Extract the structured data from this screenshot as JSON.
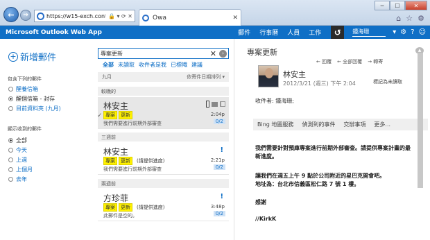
{
  "browser": {
    "url": "https://w15-exch.conto...",
    "tab_title": "Owa",
    "url_symbols": "🔒 ▾ ⟳ ✕",
    "win_min": "─",
    "win_max": "☐",
    "win_close": "✕",
    "toolbar_icons": [
      "⌂",
      "☆",
      "⚙"
    ]
  },
  "owa": {
    "brand": "Microsoft Outlook Web App",
    "nav": [
      "郵件",
      "行事曆",
      "人員",
      "工作"
    ],
    "logo": "↺",
    "user": "鍾海珊 ",
    "top_icons": [
      "▾",
      "⚙",
      "?",
      "☺"
    ]
  },
  "sidebar": {
    "new_mail": "新增郵件",
    "section1": "包含下列的郵件",
    "folders": [
      "醒養信箱",
      "醒個信箱 - 封存",
      "目前資料夾 (九月)"
    ],
    "section2": "顯示收到的郵件",
    "ranges": [
      "全部",
      "今天",
      "上週",
      "上個月",
      "去年"
    ]
  },
  "list": {
    "search": "專案更新",
    "filters": [
      "全部",
      "未讀取",
      "收件者是我",
      "已標幟",
      "建議"
    ],
    "header_left": "九月",
    "header_right": "依寄件日期排列 ▾",
    "groups": [
      "較晚的",
      "三週前",
      "兩週前"
    ],
    "items": [
      {
        "name": "林安主",
        "tag1": "專案",
        "tag2": "更新",
        "subject": "",
        "preview": "我們需要進行前期外部審查",
        "time": "2:04p",
        "count": "0/2"
      },
      {
        "name": "林安主",
        "tag1": "專案",
        "tag2": "更新",
        "subject": "(請提供進度)",
        "preview": "我們需要進行前期外部審查",
        "time": "2:21p",
        "count": "0/2"
      },
      {
        "name": "方珍菲",
        "tag1": "專案",
        "tag2": "更新",
        "subject": "(請提供進度)",
        "preview": "此郵件是空的。",
        "time": "3:48p",
        "count": "0/2"
      }
    ],
    "important": "!",
    "check": "✓"
  },
  "reading": {
    "title": "專案更新",
    "actions": [
      "← 回覆",
      "← 全部回覆",
      "→ 轉寄"
    ],
    "sender": "林安主",
    "date": "2012/3/21 (週三) 下午 2:04",
    "mark_unread": "標記為未讀取",
    "recipients": "收件者: 鍾海珊;",
    "addin_tabs": [
      "Bing 地圖服務",
      "偵測到的事件",
      "交辦事項",
      "更多..."
    ],
    "body": [
      "我們需要針對預庫專案進行前期外部審查。請提供專案計畫的最新進度。",
      "讓我們在週五上午 9 點於公司附近的星巴克開會吧。",
      "地址為：台北市信義區松仁路 7 號 1 樓。",
      "感謝",
      "//KirkK"
    ]
  }
}
